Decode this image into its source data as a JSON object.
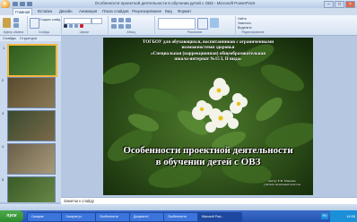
{
  "window": {
    "title": "Особенности проектной деятельности в обучении детей с ОВЗ - Microsoft PowerPoint",
    "min": "–",
    "max": "□",
    "close": "×"
  },
  "ribbon": {
    "tabs": [
      "Главная",
      "Вставка",
      "Дизайн",
      "Анимация",
      "Показ слайдов",
      "Рецензирование",
      "Вид",
      "Формат"
    ],
    "groups": [
      "Буфер обмена",
      "Слайды",
      "Шрифт",
      "Абзац",
      "Рисование",
      "Редактирование"
    ],
    "font_name": "",
    "font_size": "",
    "create_slide": "Создать слайд",
    "find": "Найти",
    "replace": "Заменить",
    "select": "Выделить"
  },
  "panel": {
    "tab_slides": "Слайды",
    "tab_outline": "Структура"
  },
  "thumbnails": [
    {
      "num": "1",
      "selected": true,
      "color": "#3d6a2a"
    },
    {
      "num": "2",
      "selected": false,
      "color": "#6b5a3a"
    },
    {
      "num": "3",
      "selected": false,
      "color": "#4a5a3a"
    },
    {
      "num": "4",
      "selected": false,
      "color": "#7a6f5a"
    },
    {
      "num": "5",
      "selected": false,
      "color": "#4d6a38"
    }
  ],
  "slide": {
    "header_line1": "ТОГБОУ для обучающихся, воспитанников с ограниченными",
    "header_line2": "возможностями здоровья",
    "header_line3": "«Специальная (коррекционная) общеобразовательная",
    "header_line4": "школа-интернат №15 I, II вида»",
    "title_line1": "Особенности проектной деятельности",
    "title_line2": "в обучении детей с ОВЗ",
    "author_line1": "Автор: Е.В. Макеева,",
    "author_line2": "учитель начальных классов"
  },
  "notes_placeholder": "Заметки к слайду",
  "taskbar": {
    "start": "пуск",
    "tasks": [
      "Сахаров",
      "Сахаров уч.",
      "Особенности",
      "Документ1",
      "Особенности",
      "Microsoft Pow..."
    ],
    "lang": "RU",
    "clock": "14:55"
  },
  "colors": {
    "slide_text": "#ffffff",
    "title_shadow": "#000000",
    "selected_thumb": "#f4b740"
  }
}
